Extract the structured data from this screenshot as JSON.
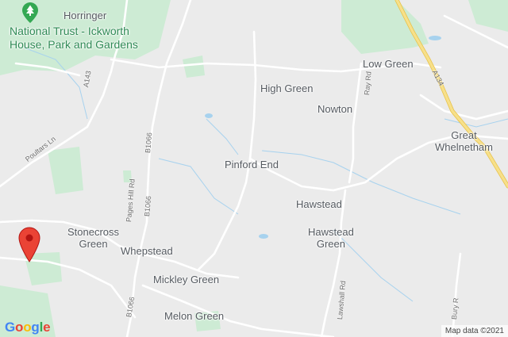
{
  "map": {
    "places": [
      {
        "id": "horringer",
        "name": "Horringer"
      },
      {
        "id": "high-green",
        "name": "High Green"
      },
      {
        "id": "low-green",
        "name": "Low Green"
      },
      {
        "id": "nowton",
        "name": "Nowton"
      },
      {
        "id": "great-whelnetham",
        "name": "Great\nWhelnetham"
      },
      {
        "id": "pinford-end",
        "name": "Pinford End"
      },
      {
        "id": "hawstead",
        "name": "Hawstead"
      },
      {
        "id": "hawstead-green",
        "name": "Hawstead\nGreen"
      },
      {
        "id": "stonecross-green",
        "name": "Stonecross\nGreen"
      },
      {
        "id": "whepstead",
        "name": "Whepstead"
      },
      {
        "id": "mickley-green",
        "name": "Mickley Green"
      },
      {
        "id": "melon-green",
        "name": "Melon Green"
      }
    ],
    "poi": {
      "name": "National Trust - Ickworth\nHouse, Park and Gardens",
      "icon": "tree-icon"
    },
    "roads": [
      {
        "id": "a143",
        "label": "A143"
      },
      {
        "id": "poultars-ln",
        "label": "Poultars Ln"
      },
      {
        "id": "b1066-1",
        "label": "B1066"
      },
      {
        "id": "pages-hill-rd",
        "label": "Pages Hill Rd"
      },
      {
        "id": "b1066-2",
        "label": "B1066"
      },
      {
        "id": "b1066-3",
        "label": "B1066"
      },
      {
        "id": "a134",
        "label": "A134"
      },
      {
        "id": "ray-rd",
        "label": "Ray Rd"
      },
      {
        "id": "lawshall-rd",
        "label": "Lawshall Rd"
      },
      {
        "id": "bury-rd",
        "label": "Bury R"
      }
    ],
    "marker": {
      "icon": "location-pin-icon",
      "color": "#ea4335"
    },
    "colors": {
      "land": "#ebebeb",
      "park": "#cdebd4",
      "water": "#a7d2ee",
      "major_road": "#f7e08a",
      "minor_road": "#ffffff"
    }
  },
  "footer": {
    "logo_letters": [
      "G",
      "o",
      "o",
      "g",
      "l",
      "e"
    ],
    "logo_colors": [
      "#4285f4",
      "#ea4335",
      "#fbbc05",
      "#4285f4",
      "#34a853",
      "#ea4335"
    ],
    "attribution": "Map data ©2021"
  }
}
